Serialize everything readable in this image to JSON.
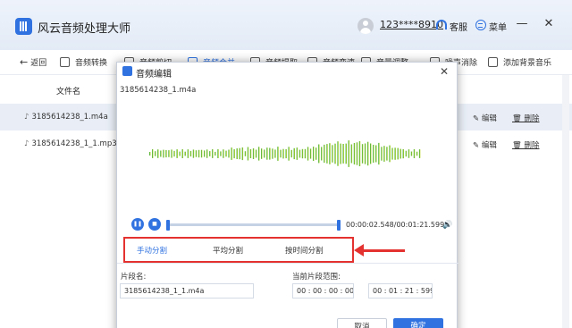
{
  "app": {
    "title": "风云音频处理大师",
    "user": "123****8910",
    "service_label": "客服",
    "menu_label": "菜单"
  },
  "toolbar": {
    "back": "返回",
    "items": [
      "音频转换",
      "音频剪切",
      "音频合并",
      "音频提取",
      "音频变速",
      "音量调整",
      "噪声消除",
      "添加背景音乐"
    ]
  },
  "list": {
    "header": "文件名",
    "rows": [
      {
        "name": "3185614238_1.m4a",
        "edit": "编辑",
        "delete": "删除"
      },
      {
        "name": "3185614238_1_1.mp3",
        "edit": "编辑",
        "delete": "删除"
      }
    ]
  },
  "dialog": {
    "title": "音频编辑",
    "file": "3185614238_1.m4a",
    "time": "00:00:02.548/00:01:21.599",
    "tabs": [
      "手动分割",
      "平均分割",
      "按时间分割"
    ],
    "segment_label": "片段名:",
    "segment_value": "3185614238_1_1.m4a",
    "range_label": "当前片段范围:",
    "range_start": "00 : 00 : 00 : 000",
    "range_end": "00 : 01 : 21 : 599",
    "cancel": "取消",
    "ok": "确定"
  },
  "colors": {
    "accent": "#2f72e0",
    "highlight": "#e3322f",
    "wave_start": "#2fa84f",
    "wave_end": "#c6d81f"
  }
}
